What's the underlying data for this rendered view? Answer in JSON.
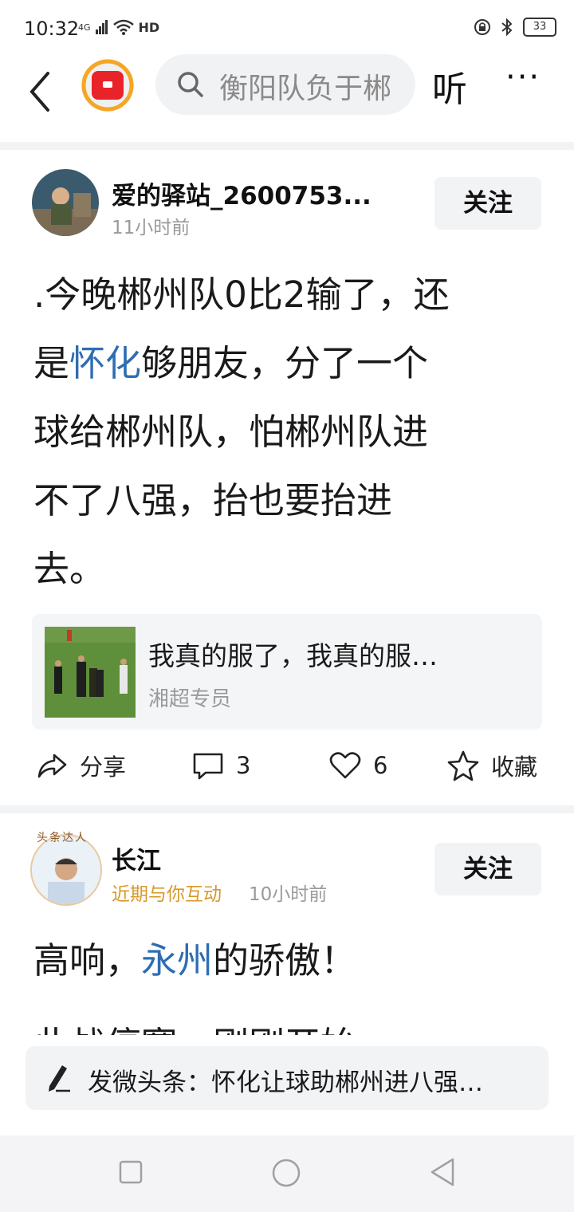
{
  "status_bar": {
    "time": "10:32",
    "network": "4G",
    "hd": "HD",
    "battery": "33"
  },
  "top_nav": {
    "search_placeholder": "衡阳队负于郴",
    "listen_label": "听",
    "more_label": "···"
  },
  "post1": {
    "username": "爱的驿站_2600753...",
    "time": "11小时前",
    "follow_label": "关注",
    "line1": ".今晚郴州队0比2输了，还",
    "line2_pre": "是",
    "line2_link": "怀化",
    "line2_post": "够朋友，分了一个",
    "line3": "球给郴州队，怕郴州队进",
    "line4": "不了八强，抬也要抬进",
    "line5": "去。",
    "quote": {
      "title": "我真的服了，我真的服…",
      "author": "湘超专员"
    },
    "actions": {
      "share_label": "分享",
      "comments": "3",
      "likes": "6",
      "favorite_label": "收藏"
    }
  },
  "post2": {
    "username": "长江",
    "badge": "近期与你互动",
    "time": "10小时前",
    "follow_label": "关注",
    "avatar_badge": "头条达人",
    "line1_pre": "高响，",
    "line1_link": "永州",
    "line1_post": "的骄傲！",
    "line2_partial": "此战停赛，刚刚开始"
  },
  "comment_bar": {
    "text": "发微头条：怀化让球助郴州进八强…"
  },
  "colors": {
    "link": "#2d6db2",
    "badge_orange": "#d8982a",
    "logo_red": "#e8242a",
    "logo_ring": "#f5a623"
  }
}
